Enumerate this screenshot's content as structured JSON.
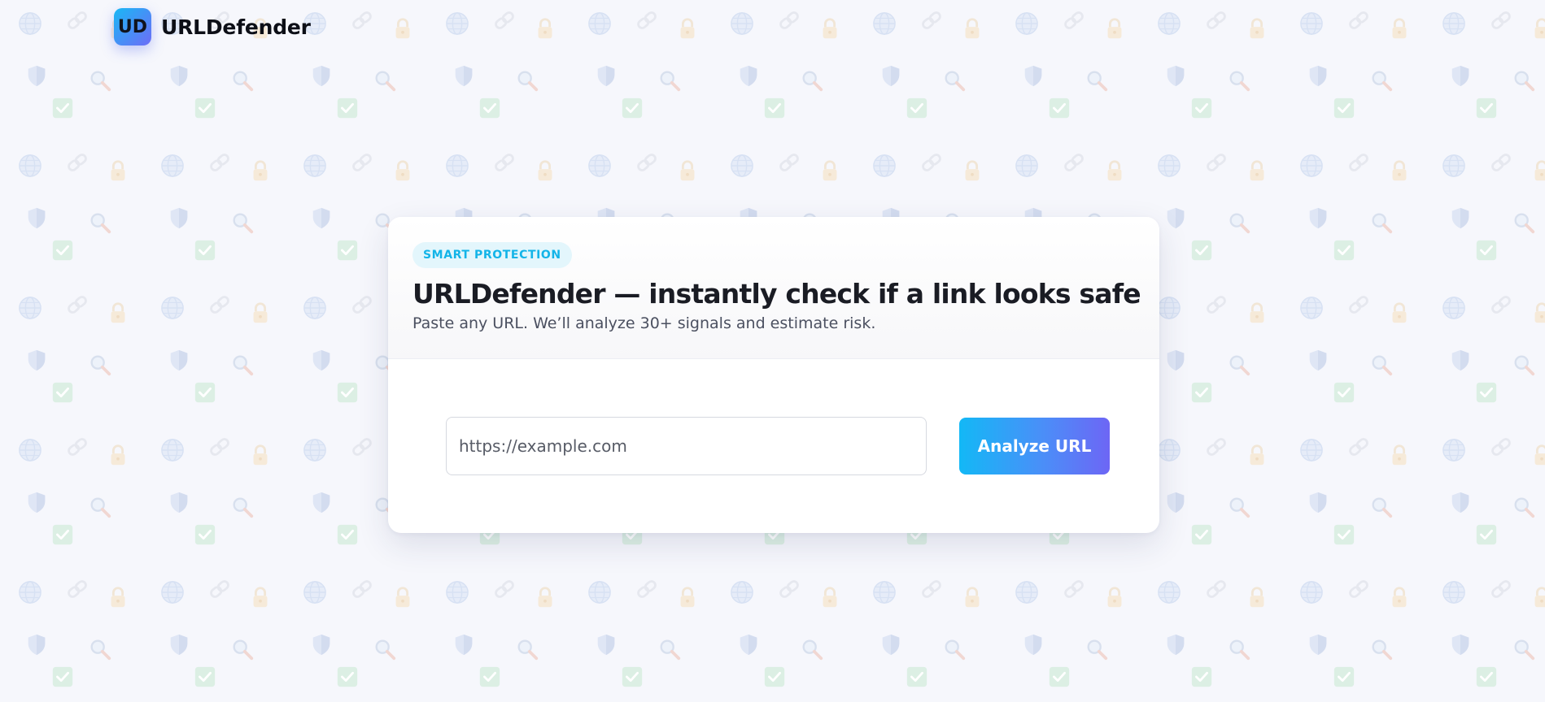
{
  "brand": {
    "logo_text": "UD",
    "name": "URLDefender"
  },
  "hero": {
    "badge": "SMART PROTECTION",
    "title": "URLDefender — instantly check if a link looks safe",
    "subtitle": "Paste any URL. We’ll analyze 30+ signals and estimate risk."
  },
  "form": {
    "url_placeholder": "https://example.com",
    "url_value": "",
    "submit_label": "Analyze URL"
  },
  "background": {
    "icons": [
      "globe-icon",
      "link-icon",
      "lock-icon",
      "shield-icon",
      "magnifier-icon",
      "checkbox-icon"
    ]
  },
  "colors": {
    "accent_start": "#13b8f6",
    "accent_end": "#6d66f5",
    "badge_text": "#13b4e8",
    "badge_bg": "#e3f6fc",
    "page_bg": "#f6f7fc"
  }
}
